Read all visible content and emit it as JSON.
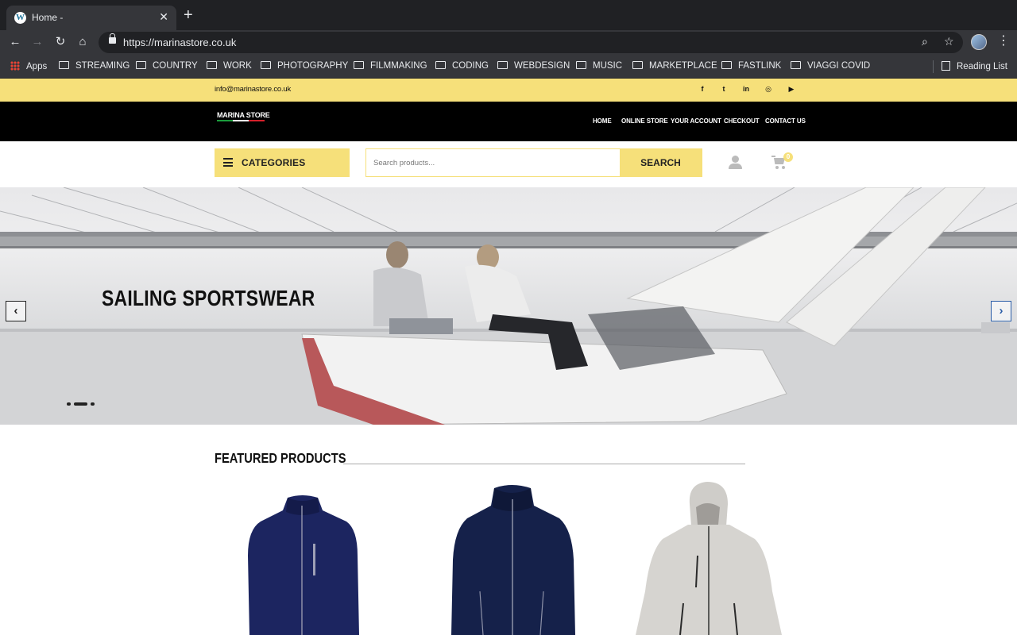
{
  "browser": {
    "tab_title": "Home -",
    "tab_favicon": "W",
    "url": "https://marinastore.co.uk",
    "icons": {
      "back": "back-arrow-icon",
      "forward": "forward-arrow-icon",
      "reload": "reload-icon",
      "home": "home-icon",
      "zoom": "magnifier-icon",
      "bookmark": "star-icon",
      "menu": "kebab-menu-icon"
    },
    "bookmarks": [
      "Apps",
      "STREAMING",
      "COUNTRY",
      "WORK",
      "PHOTOGRAPHY",
      "FILMMAKING",
      "CODING",
      "WEBDESIGN",
      "MUSIC",
      "MARKETPLACE",
      "FASTLINK",
      "VIAGGI COVID"
    ],
    "reading_list": "Reading List"
  },
  "site": {
    "colors": {
      "accent": "#f6e07a",
      "header_bg": "#000000"
    },
    "topbar": {
      "email": "info@marinastore.co.uk",
      "social_icons": [
        "facebook-icon",
        "twitter-icon",
        "linkedin-icon",
        "instagram-icon",
        "youtube-icon"
      ],
      "social_glyphs": [
        "f",
        "t",
        "in",
        "◎",
        "▶"
      ]
    },
    "logo_text": "MARINA STORE",
    "menu": [
      "HOME",
      "ONLINE STORE",
      "YOUR ACCOUNT",
      "CHECKOUT",
      "CONTACT US"
    ],
    "categories_label": "CATEGORIES",
    "search": {
      "placeholder": "Search products...",
      "button": "SEARCH"
    },
    "cart_count": "0",
    "hero": {
      "title": "SAILING SPORTSWEAR",
      "prev": "‹",
      "next": "›"
    },
    "featured": {
      "title": "FEATURED PRODUCTS"
    }
  }
}
